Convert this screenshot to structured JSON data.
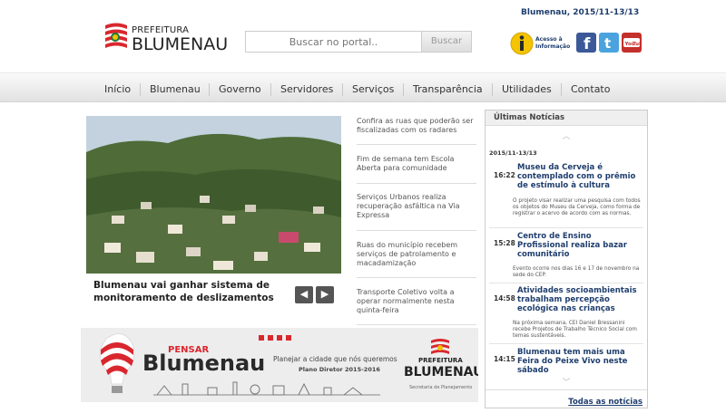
{
  "header": {
    "logo_small": "PREFEITURA",
    "logo_big": "BLUMENAU",
    "date_line": "Blumenau, 2015/11-13/13",
    "search": {
      "placeholder": "Buscar no portal..",
      "button_label": "Buscar"
    },
    "info_label": "Acesso à Informação",
    "social": [
      {
        "name": "facebook-icon",
        "color": "#3b5998",
        "glyph": "f"
      },
      {
        "name": "twitter-icon",
        "color": "#4aa3df",
        "glyph": "t"
      },
      {
        "name": "youtube-icon",
        "color": "#c4302b",
        "glyph": "You Tube"
      }
    ]
  },
  "nav": {
    "items": [
      "Início",
      "Blumenau",
      "Governo",
      "Servidores",
      "Serviços",
      "Transparência",
      "Utilidades",
      "Contato"
    ]
  },
  "hero": {
    "caption": "Blumenau vai ganhar sistema de monitoramento de deslizamentos",
    "prev_glyph": "◀",
    "next_glyph": "▶"
  },
  "side_news": [
    "Confira as ruas que poderão ser fiscalizadas com os radares",
    "Fim de semana tem Escola Aberta para comunidade",
    "Serviços Urbanos realiza recuperação asfáltica na Via Expressa",
    "Ruas do município recebem serviços de patrolamento e macadamização",
    "Transporte Coletivo volta a operar normalmente nesta quinta-feira"
  ],
  "banner": {
    "title_small": "PENSAR",
    "title_big": "Blumenau",
    "tagline": "Planejar a cidade que nós queremos",
    "subtitle": "Plano Diretor 2015-2016",
    "org_small": "PREFEITURA",
    "org_big": "BLUMENAU",
    "org_sub": "Secretaria de Planejamento"
  },
  "latest": {
    "title": "Últimas Notícias",
    "date": "2015/11-13/13",
    "items": [
      {
        "time": "16:22",
        "title": "Museu da Cerveja é contemplado com o prêmio de estímulo à cultura",
        "desc": "O projeto visar realizar uma pesquisa com todos os objetos do Museu da Cerveja, como forma de registrar o acervo de acordo com as normas."
      },
      {
        "time": "15:28",
        "title": "Centro de Ensino Profissional realiza bazar comunitário",
        "desc": "Evento ocorre nos dias 16 e 17 de novembro na sede do CEP."
      },
      {
        "time": "14:58",
        "title": "Atividades socioambientais trabalham percepção ecológica nas crianças",
        "desc": "Na próxima semana, CEI Daniel Bressanini recebe Projetos de Trabalho Técnico Social com temas sustentáveis."
      },
      {
        "time": "14:15",
        "title": "Blumenau tem mais uma Feira do Peixe Vivo neste sábado",
        "desc": ""
      }
    ],
    "chev_up": "︿",
    "chev_down": "﹀",
    "all_link": "Todas as notícias"
  }
}
